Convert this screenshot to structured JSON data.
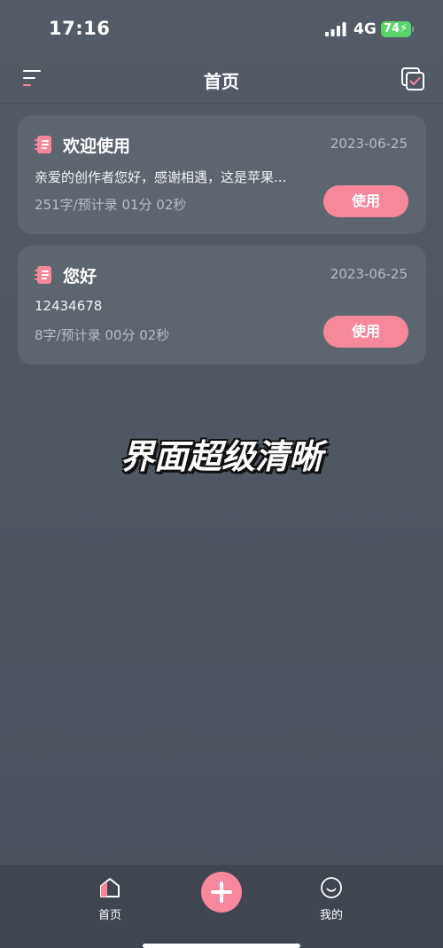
{
  "status_bar": {
    "time": "17:16",
    "network": "4G",
    "battery": "74"
  },
  "nav": {
    "title": "首页"
  },
  "scripts": [
    {
      "title": "欢迎使用",
      "date": "2023-06-25",
      "preview": "亲爱的创作者您好，感谢相遇，这是苹果...",
      "meta": "251字/预计录 01分 02秒",
      "action_label": "使用"
    },
    {
      "title": "您好",
      "date": "2023-06-25",
      "preview": "12434678",
      "meta": "8字/预计录 00分 02秒",
      "action_label": "使用"
    }
  ],
  "overlay_caption": "界面超级清晰",
  "tabs": {
    "home_label": "首页",
    "mine_label": "我的"
  },
  "colors": {
    "accent": "#f7889c",
    "background": "#4f5763",
    "card": "#5d656f",
    "battery": "#5bd36b"
  },
  "icons": [
    "menu-icon",
    "check-square-icon",
    "notebook-icon",
    "home-icon",
    "plus-icon",
    "smile-icon"
  ]
}
